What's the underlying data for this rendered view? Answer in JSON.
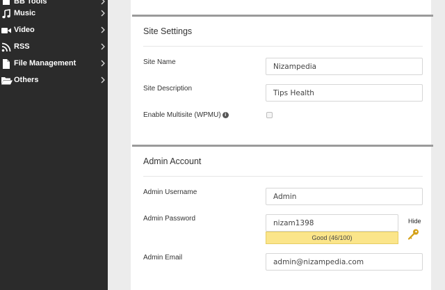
{
  "sidebar": {
    "items": [
      {
        "label": "BB Tools",
        "icon": "tools-icon"
      },
      {
        "label": "Music",
        "icon": "music-icon"
      },
      {
        "label": "Video",
        "icon": "video-icon"
      },
      {
        "label": "RSS",
        "icon": "rss-icon"
      },
      {
        "label": "File Management",
        "icon": "file-icon"
      },
      {
        "label": "Others",
        "icon": "folder-icon"
      }
    ]
  },
  "site_settings": {
    "title": "Site Settings",
    "site_name_label": "Site Name",
    "site_name_value": "Nizampedia",
    "site_description_label": "Site Description",
    "site_description_value": "Tips Health",
    "multisite_label": "Enable Multisite (WPMU)",
    "multisite_checked": false
  },
  "admin_account": {
    "title": "Admin Account",
    "username_label": "Admin Username",
    "username_value": "Admin",
    "password_label": "Admin Password",
    "password_value": "nizam1398",
    "password_strength": "Good (46/100)",
    "hide_label": "Hide",
    "email_label": "Admin Email",
    "email_value": "admin@nizampedia.com"
  },
  "colors": {
    "sidebar_bg": "#2b2b2b",
    "strength_bar": "#fbe58a",
    "key_icon": "#d4a017"
  }
}
